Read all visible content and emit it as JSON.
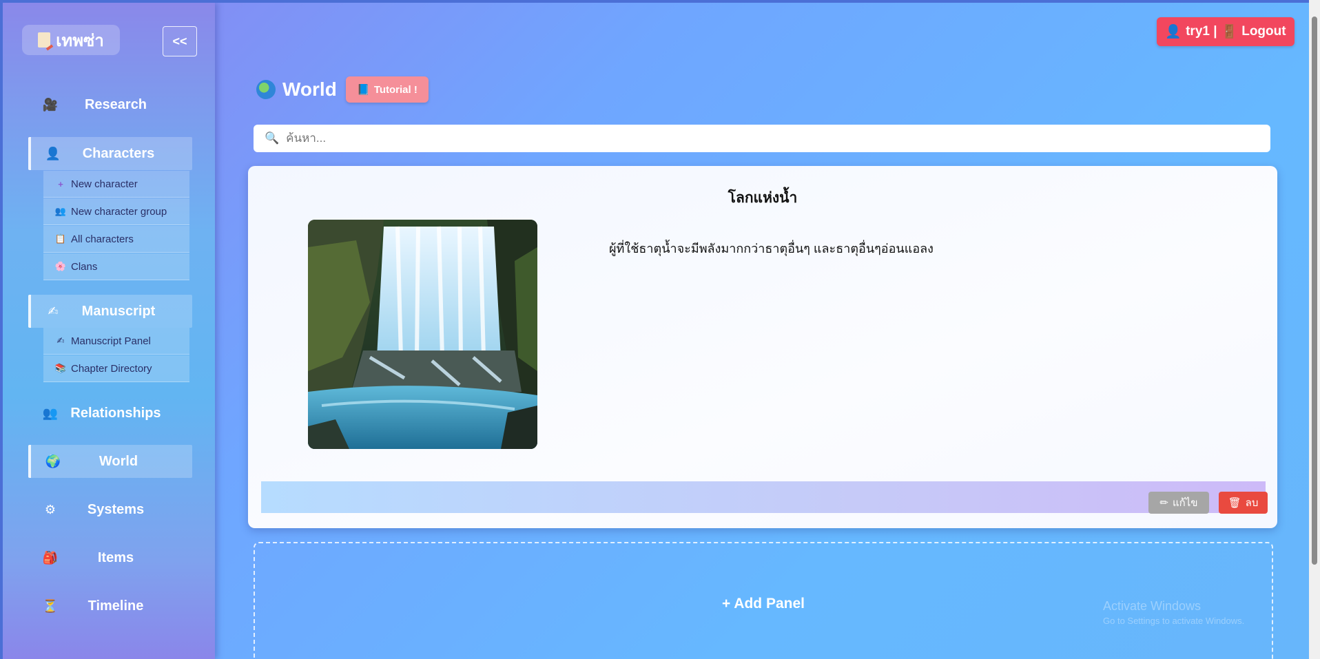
{
  "app": {
    "logo_text": "เทพซ่า",
    "collapse_label": "<<"
  },
  "sidebar": {
    "items": [
      {
        "label": "Research",
        "icon": "camera-icon"
      },
      {
        "label": "Characters",
        "icon": "person-icon",
        "children": [
          {
            "label": "New character",
            "icon": "plus-icon"
          },
          {
            "label": "New character group",
            "icon": "group-icon"
          },
          {
            "label": "All characters",
            "icon": "clipboard-icon"
          },
          {
            "label": "Clans",
            "icon": "flower-icon"
          }
        ]
      },
      {
        "label": "Manuscript",
        "icon": "writing-hand-icon",
        "children": [
          {
            "label": "Manuscript Panel",
            "icon": "writing-hand-icon"
          },
          {
            "label": "Chapter Directory",
            "icon": "books-icon"
          }
        ]
      },
      {
        "label": "Relationships",
        "icon": "people-icon"
      },
      {
        "label": "World",
        "icon": "globe-icon"
      },
      {
        "label": "Systems",
        "icon": "gear-icon"
      },
      {
        "label": "Items",
        "icon": "bag-icon"
      },
      {
        "label": "Timeline",
        "icon": "hourglass-icon"
      }
    ]
  },
  "header": {
    "user_label": "try1 |",
    "logout_label": "Logout",
    "page_title": "World",
    "tutorial_label": "Tutorial !"
  },
  "search": {
    "placeholder": "ค้นหา..."
  },
  "panel": {
    "title": "โลกแห่งน้ำ",
    "description": "ผู้ที่ใช้ธาตุน้ำจะมีพลังมากกว่าธาตุอื่นๆ และธาตุอื่นๆอ่อนแอลง",
    "image_subject": "waterfall",
    "edit_label": "แก้ไข",
    "delete_label": "ลบ"
  },
  "add_panel_label": "+ Add Panel",
  "watermark": {
    "line1": "Activate Windows",
    "line2": "Go to Settings to activate Windows."
  },
  "colors": {
    "logout_button": "#f2475e",
    "tutorial_button": "#f58f99",
    "edit_button": "#a6a6a6",
    "delete_button": "#e94a3f"
  }
}
